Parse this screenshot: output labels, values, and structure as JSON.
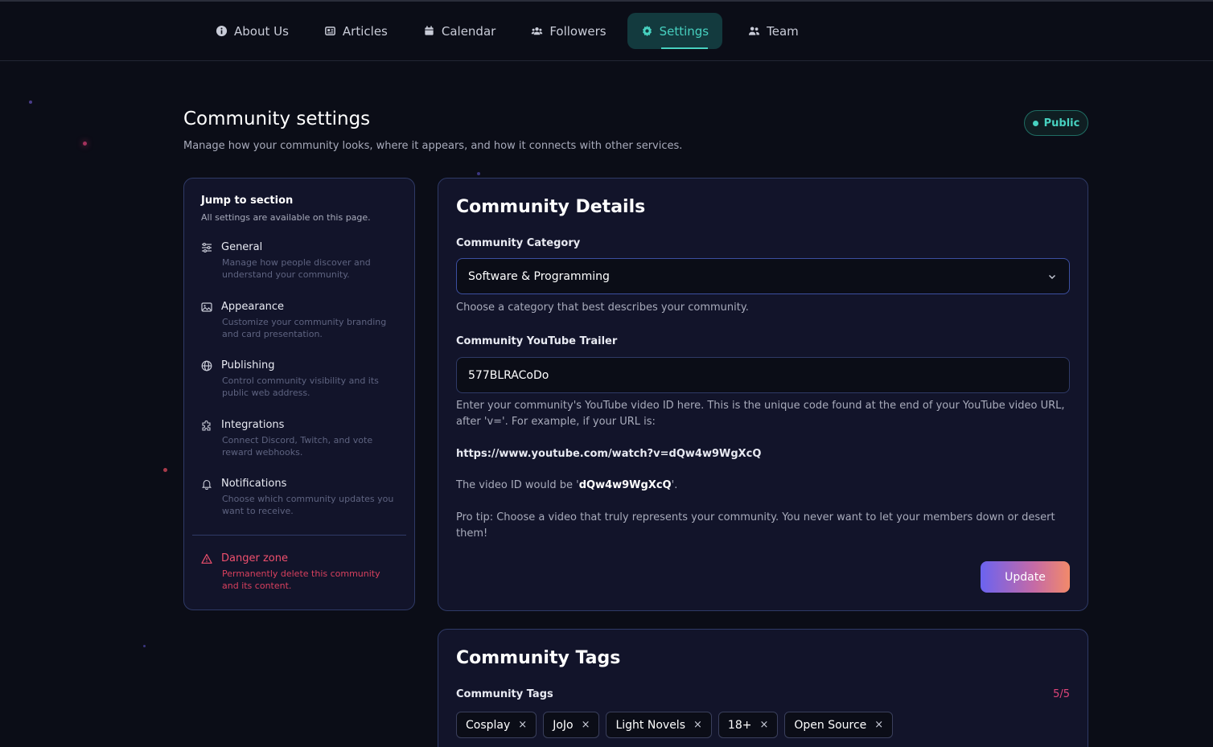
{
  "nav": {
    "items": [
      {
        "label": "About Us",
        "icon": "info-icon"
      },
      {
        "label": "Articles",
        "icon": "newspaper-icon"
      },
      {
        "label": "Calendar",
        "icon": "calendar-icon"
      },
      {
        "label": "Followers",
        "icon": "users-icon"
      },
      {
        "label": "Settings",
        "icon": "gear-icon",
        "active": true
      },
      {
        "label": "Team",
        "icon": "team-icon"
      }
    ]
  },
  "header": {
    "title": "Community settings",
    "subtitle": "Manage how your community looks, where it appears, and how it connects with other services.",
    "badge": "Public"
  },
  "sidebar": {
    "title": "Jump to section",
    "subtitle": "All settings are available on this page.",
    "items": [
      {
        "label": "General",
        "desc": "Manage how people discover and understand your community."
      },
      {
        "label": "Appearance",
        "desc": "Customize your community branding and card presentation."
      },
      {
        "label": "Publishing",
        "desc": "Control community visibility and its public web address."
      },
      {
        "label": "Integrations",
        "desc": "Connect Discord, Twitch, and vote reward webhooks."
      },
      {
        "label": "Notifications",
        "desc": "Choose which community updates you want to receive."
      }
    ],
    "danger": {
      "label": "Danger zone",
      "desc": "Permanently delete this community and its content."
    }
  },
  "details": {
    "title": "Community Details",
    "category_label": "Community Category",
    "category_value": "Software & Programming",
    "category_help": "Choose a category that best describes your community.",
    "trailer_label": "Community YouTube Trailer",
    "trailer_value": "577BLRACoDo",
    "trailer_help": "Enter your community's YouTube video ID here. This is the unique code found at the end of your YouTube video URL, after 'v='. For example, if your URL is:",
    "example_url": "https://www.youtube.com/watch?v=dQw4w9WgXcQ",
    "video_id_prefix": "The video ID would be '",
    "video_id": "dQw4w9WgXcQ",
    "video_id_suffix": "'.",
    "pro_tip": "Pro tip: Choose a video that truly represents your community. You never want to let your members down or desert them!",
    "update_label": "Update"
  },
  "tags": {
    "title": "Community Tags",
    "label": "Community Tags",
    "count": "5/5",
    "items": [
      "Cosplay",
      "JoJo",
      "Light Novels",
      "18+",
      "Open Source"
    ],
    "remove_glyph": "×"
  },
  "colors": {
    "accent": "#47d1c0",
    "danger": "#f0506e",
    "count": "#e0457a"
  }
}
